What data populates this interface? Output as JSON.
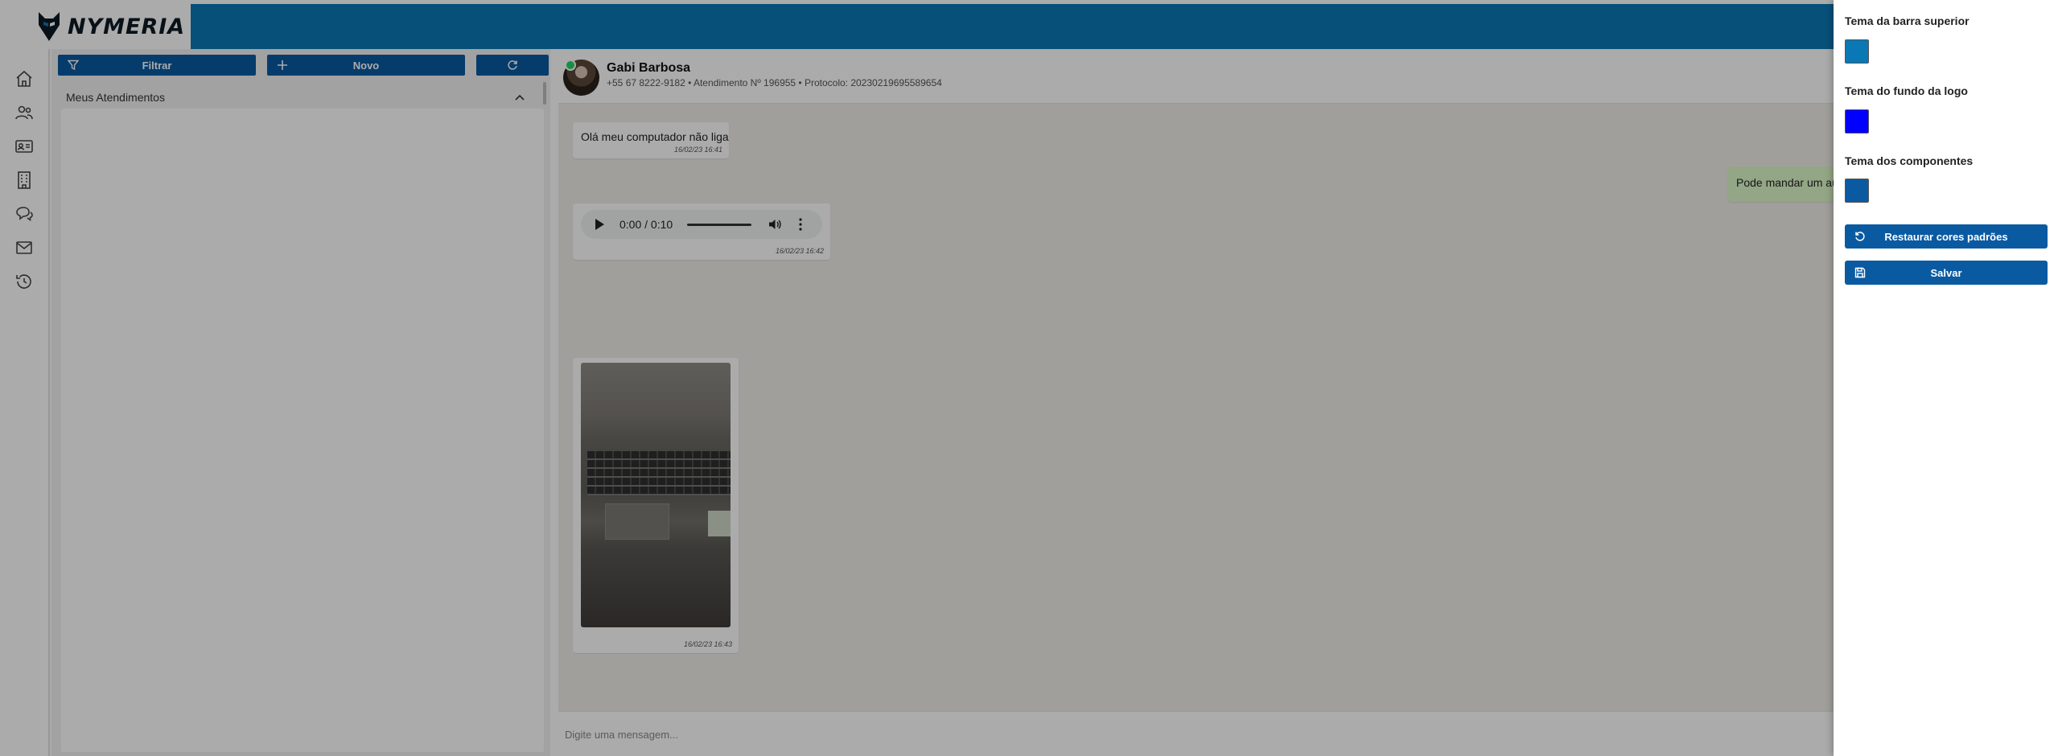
{
  "app": {
    "logo_text": "NYMERIA"
  },
  "colors": {
    "topbar": "#0a78b5",
    "accent": "#0a5aa2"
  },
  "nav": {
    "items": [
      "home-icon",
      "users-icon",
      "contact-card-icon",
      "building-icon",
      "chat-icon",
      "mail-icon",
      "history-icon"
    ]
  },
  "list_panel": {
    "filter_label": "Filtrar",
    "new_label": "Novo",
    "refresh_icon": "refresh-icon",
    "section_title": "Meus Atendimentos"
  },
  "chat": {
    "contact_name": "Gabi Barbosa",
    "contact_meta": "+55 67 8222-9182 • Atendimento Nº 196955  • Protocolo: 20230219695589654",
    "messages": [
      {
        "type": "text",
        "direction": "in",
        "text": "Olá meu computador não liga",
        "time": "16/02/23 16:41"
      },
      {
        "type": "text",
        "direction": "out",
        "text": "Pode mandar um au"
      },
      {
        "type": "audio",
        "direction": "in",
        "audio_time": "0:00 / 0:10",
        "time": "16/02/23 16:42"
      },
      {
        "type": "image",
        "direction": "in",
        "time": "16/02/23 16:43"
      }
    ],
    "composer_placeholder": "Digite uma mensagem..."
  },
  "theme_drawer": {
    "topbar_theme_label": "Tema da barra superior",
    "topbar_theme_color": "#0a78b5",
    "logo_bg_theme_label": "Tema do fundo da logo",
    "logo_bg_theme_color": "#0000ff",
    "components_theme_label": "Tema dos componentes",
    "components_theme_color": "#0a5aa2",
    "restore_label": "Restaurar cores padrões",
    "save_label": "Salvar"
  }
}
